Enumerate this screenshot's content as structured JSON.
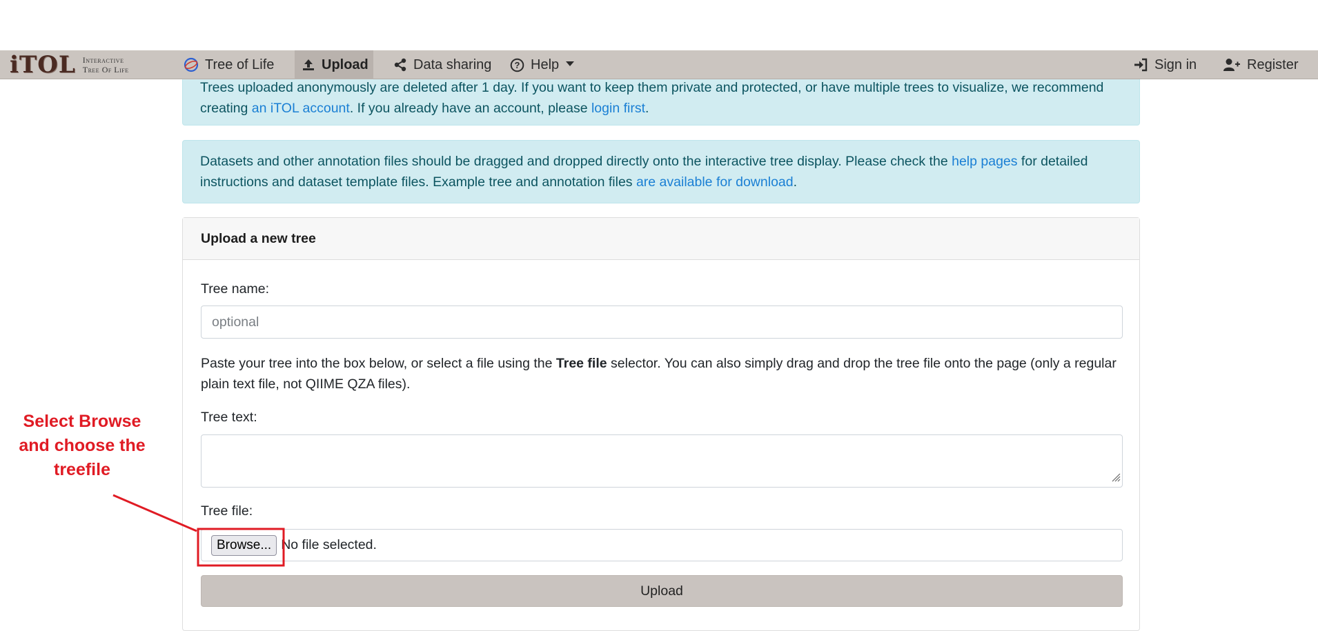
{
  "navbar": {
    "brand_logo": "iTOL",
    "brand_sub_1": "Interactive",
    "brand_sub_2": "Tree Of Life",
    "items": [
      {
        "label": "Tree of Life",
        "icon": "globe-icon"
      },
      {
        "label": "Upload",
        "icon": "upload-icon"
      },
      {
        "label": "Data sharing",
        "icon": "share-icon"
      },
      {
        "label": "Help",
        "icon": "help-circle-icon"
      }
    ],
    "sign_in": "Sign in",
    "register": "Register"
  },
  "alerts": {
    "anon": {
      "part1": "Trees uploaded anonymously are deleted after 1 day. If you want to keep them private and protected, or have multiple trees to visualize, we recommend creating ",
      "link1": "an iTOL account",
      "part2": ". If you already have an account, please ",
      "link2": "login first",
      "part3": "."
    },
    "datasets": {
      "part1": "Datasets and other annotation files should be dragged and dropped directly onto the interactive tree display. Please check the ",
      "link1": "help pages",
      "part2": " for detailed instructions and dataset template files. Example tree and annotation files ",
      "link2": "are available for download",
      "part3": "."
    }
  },
  "upload_card": {
    "title": "Upload a new tree",
    "tree_name_label": "Tree name:",
    "tree_name_placeholder": "optional",
    "tree_name_value": "",
    "instructions_part1": "Paste your tree into the box below, or select a file using the ",
    "instructions_bold": "Tree file",
    "instructions_part2": " selector. You can also simply drag and drop the tree file onto the page (only a regular plain text file, not QIIME QZA files).",
    "tree_text_label": "Tree text:",
    "tree_text_value": "",
    "tree_file_label": "Tree file:",
    "browse_label": "Browse...",
    "file_status": "No file selected.",
    "upload_button": "Upload"
  },
  "annotation": {
    "text": "Select Browse and choose the treefile",
    "color": "#e01b24"
  },
  "colors": {
    "navbar_bg": "#cbc5c0",
    "alert_bg": "#d1ecf1",
    "alert_text": "#0c5460",
    "link": "#1a7fd4"
  }
}
